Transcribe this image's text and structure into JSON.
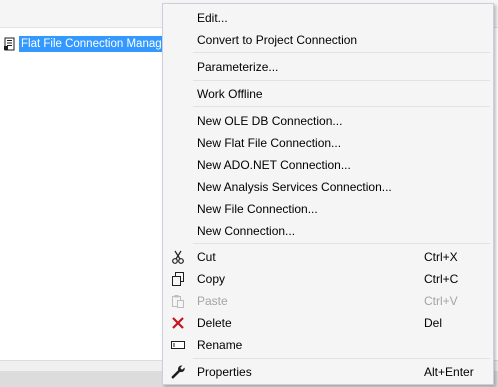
{
  "tray": {
    "connection_manager": "Flat File Connection Manager"
  },
  "context_menu": {
    "items": [
      {
        "label": "Edit..."
      },
      {
        "label": "Convert to Project Connection"
      },
      {
        "label": "Parameterize..."
      },
      {
        "label": "Work Offline"
      },
      {
        "label": "New OLE DB Connection..."
      },
      {
        "label": "New Flat File Connection..."
      },
      {
        "label": "New ADO.NET Connection..."
      },
      {
        "label": "New Analysis Services Connection..."
      },
      {
        "label": "New File Connection..."
      },
      {
        "label": "New Connection..."
      },
      {
        "label": "Cut",
        "shortcut": "Ctrl+X",
        "icon": "scissors-icon"
      },
      {
        "label": "Copy",
        "shortcut": "Ctrl+C",
        "icon": "copy-icon"
      },
      {
        "label": "Paste",
        "shortcut": "Ctrl+V",
        "icon": "paste-icon",
        "enabled": false
      },
      {
        "label": "Delete",
        "shortcut": "Del",
        "icon": "delete-icon"
      },
      {
        "label": "Rename",
        "icon": "rename-icon"
      },
      {
        "label": "Properties",
        "shortcut": "Alt+Enter",
        "icon": "wrench-icon"
      }
    ]
  },
  "colors": {
    "selection": "#3399ff",
    "menu_background": "#f5f5f5",
    "menu_border": "#cccedb",
    "delete_icon": "#c4161c",
    "disabled_text": "#a2a4a5"
  }
}
